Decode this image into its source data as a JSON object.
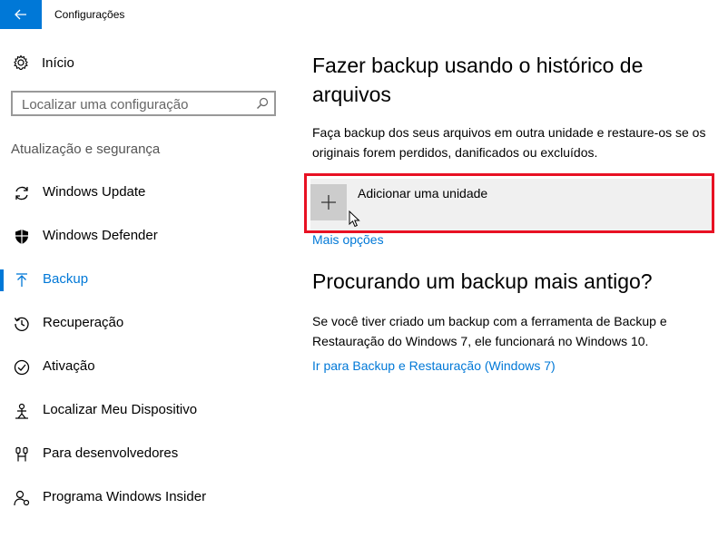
{
  "window": {
    "title": "Configurações"
  },
  "sidebar": {
    "home_label": "Início",
    "search_placeholder": "Localizar uma configuração",
    "section_label": "Atualização e segurança",
    "items": [
      {
        "label": "Windows Update",
        "icon": "refresh-icon"
      },
      {
        "label": "Windows Defender",
        "icon": "shield-icon"
      },
      {
        "label": "Backup",
        "icon": "backup-arrow-icon",
        "selected": true
      },
      {
        "label": "Recuperação",
        "icon": "history-icon"
      },
      {
        "label": "Ativação",
        "icon": "checkmark-circle-icon"
      },
      {
        "label": "Localizar Meu Dispositivo",
        "icon": "person-location-icon"
      },
      {
        "label": "Para desenvolvedores",
        "icon": "developer-tools-icon"
      },
      {
        "label": "Programa Windows Insider",
        "icon": "insider-person-icon"
      }
    ]
  },
  "main": {
    "heading": "Fazer backup usando o histórico de arquivos",
    "description": "Faça backup dos seus arquivos em outra unidade e restaure-os se os originais forem perdidos, danificados ou excluídos.",
    "add_drive_label": "Adicionar uma unidade",
    "more_options_link": "Mais opções",
    "older_backup_heading": "Procurando um backup mais antigo?",
    "older_backup_description": "Se você tiver criado um backup com a ferramenta de Backup e Restauração do Windows 7, ele funcionará no Windows 10.",
    "restore_link": "Ir para Backup e Restauração (Windows 7)"
  },
  "colors": {
    "accent": "#0078d7",
    "highlight_border": "#e81123"
  }
}
